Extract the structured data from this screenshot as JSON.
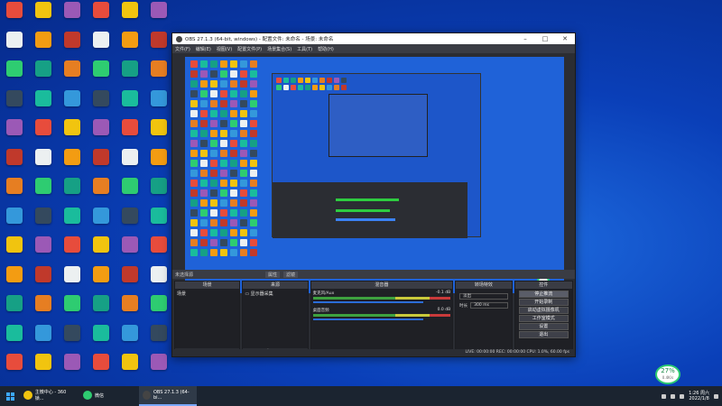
{
  "obs": {
    "title": "OBS 27.1.3 (64-bit, windows) - 配置文件: 未命名 - 场景: 未命名",
    "menu": [
      "文件(F)",
      "编辑(E)",
      "视图(V)",
      "配置文件(P)",
      "场景集合(S)",
      "工具(T)",
      "帮助(H)"
    ],
    "no_source": "未选择源",
    "props_btn": "属性",
    "filters_btn": "滤镜",
    "panels": {
      "scenes": {
        "title": "场景",
        "items": [
          "场景"
        ],
        "footer": "+ − ∧ ∨"
      },
      "sources": {
        "title": "来源",
        "items": [
          "显示器采集"
        ],
        "footer": "+ − ⚙ ∧ ∨"
      },
      "mixer": {
        "title": "混音器",
        "channels": [
          {
            "name": "麦克风/Aux",
            "db": "-0.1 dB"
          },
          {
            "name": "桌面音频",
            "db": "0.0 dB"
          }
        ]
      },
      "transitions": {
        "title": "转场特效",
        "type": "淡出",
        "duration_label": "时长",
        "duration": "300 ms"
      },
      "controls": {
        "title": "控件",
        "buttons": [
          "停止推流",
          "开始录制",
          "启动虚拟摄像机",
          "工作室模式",
          "设置",
          "退出"
        ]
      }
    },
    "status": "LIVE: 00:00:00    REC: 00:00:00    CPU: 1.0%, 60.00 fps"
  },
  "net_widget": {
    "value": "27",
    "unit": "%",
    "sub": "0.4K/s"
  },
  "taskbar": {
    "tasks": [
      {
        "label": "主微中心 - 360锁...",
        "color": "#f1c40f"
      },
      {
        "label": "微信",
        "color": "#2ecc71"
      },
      {
        "label": "OBS 27.1.3 (64-bi...",
        "color": "#444444"
      }
    ],
    "clock_time": "1:26 周六",
    "clock_date": "2022/1/8"
  }
}
